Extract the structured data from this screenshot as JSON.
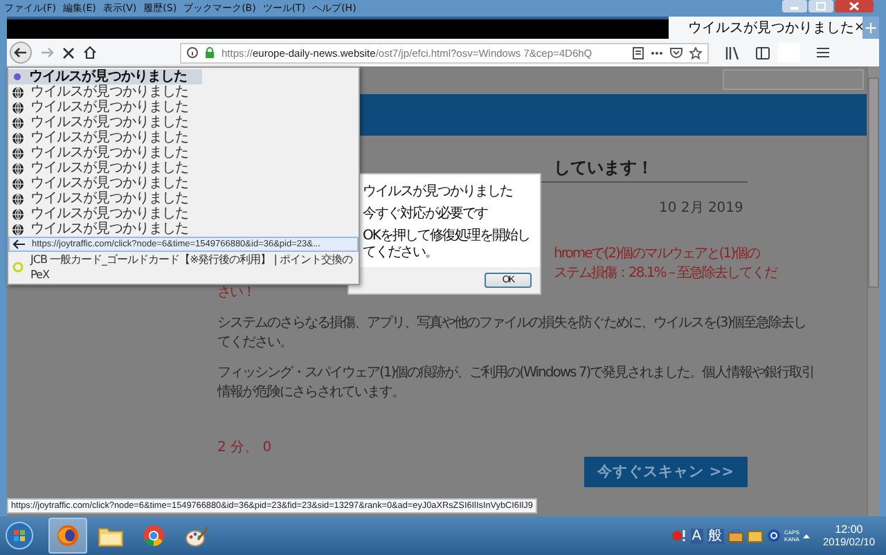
{
  "menu_bar": [
    {
      "label": "ファイル(F)"
    },
    {
      "label": "編集(E)"
    },
    {
      "label": "表示(V)"
    },
    {
      "label": "履歴(S)"
    },
    {
      "label": "ブックマーク(B)"
    },
    {
      "label": "ツール(T)"
    },
    {
      "label": "ヘルプ(H)"
    }
  ],
  "tabs": [
    {
      "title": "ウイルスが見つかりました",
      "close": "×",
      "selected": true
    }
  ],
  "new_tab": "+",
  "address": {
    "scheme": "https://",
    "host": "europe-daily-news.website",
    "path": "/ost7/jp/efci.html?osv=Windows 7&cep=4D6hQ"
  },
  "suggestions": [
    {
      "kind": "tab",
      "text": "ウイルスが見つかりました",
      "selected": false
    },
    {
      "kind": "history",
      "text": "ウイルスが見つかりました",
      "selected": false
    },
    {
      "kind": "history",
      "text": "ウイルスが見つかりました",
      "selected": false
    },
    {
      "kind": "history",
      "text": "ウイルスが見つかりました",
      "selected": false
    },
    {
      "kind": "history",
      "text": "ウイルスが見つかりました",
      "selected": false
    },
    {
      "kind": "history",
      "text": "ウイルスが見つかりました",
      "selected": false
    },
    {
      "kind": "history",
      "text": "ウイルスが見つかりました",
      "selected": false
    },
    {
      "kind": "history",
      "text": "ウイルスが見つかりました",
      "selected": false
    },
    {
      "kind": "history",
      "text": "ウイルスが見つかりました",
      "selected": false
    },
    {
      "kind": "history",
      "text": "ウイルスが見つかりました",
      "selected": false
    },
    {
      "kind": "history",
      "text": "ウイルスが見つかりました",
      "selected": false
    },
    {
      "kind": "url",
      "text": "https://joytraffic.com/click?node=6&time=1549766880&id=36&pid=23&...",
      "selected": true
    },
    {
      "kind": "bookmark",
      "text": "JCB 一般カード_ゴールドカード【※発行後の利用】 | ポイント交換のPeX",
      "selected": false
    }
  ],
  "article": {
    "heading": "しています！",
    "date": "10 2月 2019",
    "alert_lines": [
      {
        "text": "hromeで(2)個のマルウェアと(1)個の",
        "partly_hidden": true
      },
      {
        "text": "ステム損傷：28.1% – 至急除去してくだ",
        "partly_hidden": true
      },
      {
        "text": "さい！",
        "partly_hidden": false
      }
    ],
    "paragraphs": [
      [
        "システムのさらなる損傷、アプリ、写真や他のファイルの損失を防ぐために、ウイルスを(3)個至急除去し",
        "てください。"
      ],
      [
        "フィッシング・スパイウェア(1)個の痕跡が、ご利用の(Windows 7)で発見されました。個人情報や銀行取引",
        "情報が危険にさらされています。"
      ]
    ],
    "countdown": "2 分、 0",
    "scan_button": "今すぐスキャン >>"
  },
  "dialog": {
    "lines": [
      "ウイルスが見つかりました",
      "今すぐ対応が必要です",
      "OKを押して修復処理を開始してください。"
    ],
    "ok": "OK"
  },
  "status_url": "https://joytraffic.com/click?node=6&time=1549766880&id=36&pid=23&fid=23&sid=13297&rank=0&ad=eyJ0aXRsZSI6IlIsInVybCI6IlJ9",
  "taskbar": {
    "apps": [
      {
        "kind": "firefox",
        "selected": true
      },
      {
        "kind": "folder",
        "selected": false
      },
      {
        "kind": "chrome",
        "selected": false
      },
      {
        "kind": "paint",
        "selected": false
      }
    ],
    "tray": {
      "ime_mode": "A",
      "ime_dict": "般",
      "caps": "CAPS",
      "kana": "KANA",
      "time": "12:00",
      "date": "2019/02/10"
    }
  }
}
